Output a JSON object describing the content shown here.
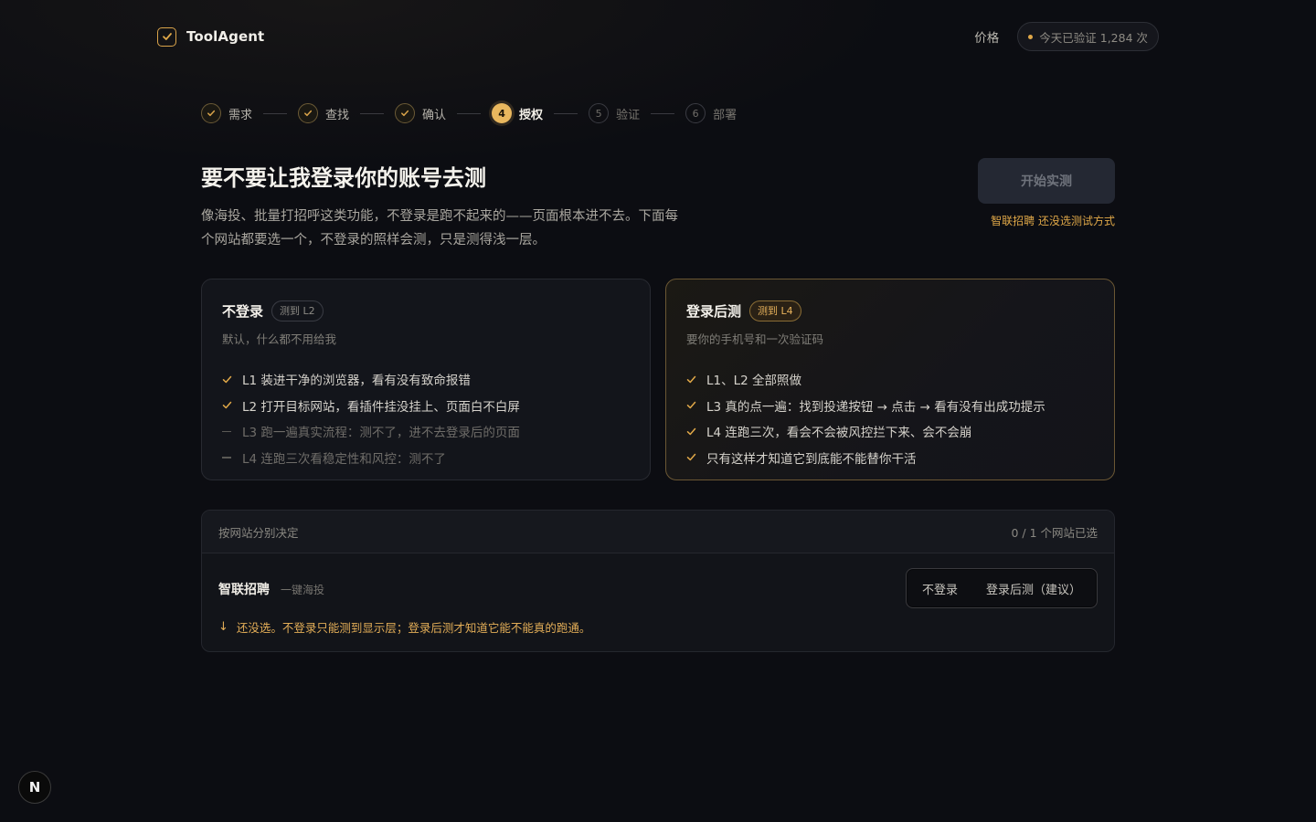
{
  "header": {
    "brand_name": "ToolAgent",
    "nav_price": "价格",
    "verify_text": "今天已验证 1,284 次"
  },
  "stepper": {
    "steps": [
      {
        "label": "需求",
        "state": "done",
        "number": ""
      },
      {
        "label": "查找",
        "state": "done",
        "number": ""
      },
      {
        "label": "确认",
        "state": "done",
        "number": ""
      },
      {
        "label": "授权",
        "state": "active",
        "number": "4"
      },
      {
        "label": "验证",
        "state": "todo",
        "number": "5"
      },
      {
        "label": "部署",
        "state": "todo",
        "number": "6"
      }
    ]
  },
  "main": {
    "title": "要不要让我登录你的账号去测",
    "subtitle": "像海投、批量打招呼这类功能，不登录是跑不起来的——页面根本进不去。下面每个网站都要选一个，不登录的照样会测，只是测得浅一层。",
    "start_button": "开始实测",
    "start_hint": "智联招聘 还没选测试方式"
  },
  "cards": [
    {
      "title": "不登录",
      "badge": "测到 L2",
      "desc": "默认，什么都不用给我",
      "features": [
        {
          "text": "L1 装进干净的浏览器，看有没有致命报错",
          "enabled": true
        },
        {
          "text": "L2 打开目标网站，看插件挂没挂上、页面白不白屏",
          "enabled": true
        },
        {
          "text": "L3 跑一遍真实流程：测不了，进不去登录后的页面",
          "enabled": false
        },
        {
          "text": "L4 连跑三次看稳定性和风控：测不了",
          "enabled": false
        }
      ]
    },
    {
      "title": "登录后测",
      "badge": "测到 L4",
      "desc": "要你的手机号和一次验证码",
      "features": [
        {
          "text": "L1、L2 全部照做",
          "enabled": true
        },
        {
          "text": "L3 真的点一遍：找到投递按钮 → 点击 → 看有没有出成功提示",
          "enabled": true
        },
        {
          "text": "L4 连跑三次，看会不会被风控拦下来、会不会崩",
          "enabled": true
        },
        {
          "text": "只有这样才知道它到底能不能替你干活",
          "enabled": true
        }
      ]
    }
  ],
  "site_panel": {
    "header_label": "按网站分别决定",
    "count_text": "0 / 1 个网站已选",
    "site_name": "智联招聘",
    "site_tag": "一键海投",
    "option_no_login": "不登录",
    "option_login": "登录后测（建议）",
    "warning": "还没选。不登录只能测到显示层；登录后测才知道它能不能真的跑通。"
  },
  "dev_badge": "N",
  "colors": {
    "accent": "#e0a848",
    "background": "#0c0d12",
    "card": "#13151b"
  }
}
